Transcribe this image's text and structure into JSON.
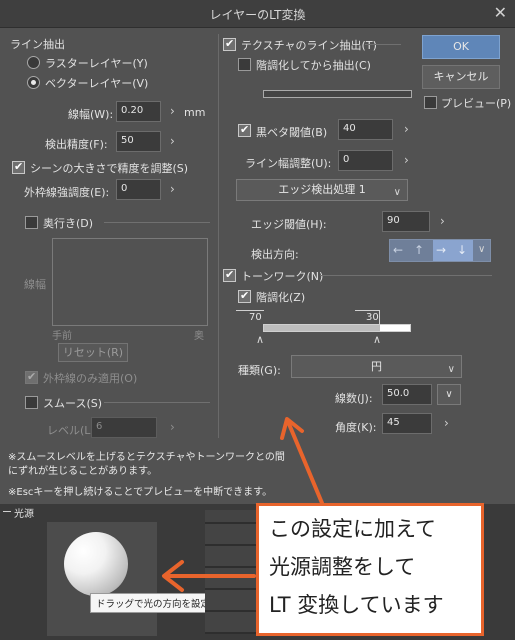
{
  "dialog": {
    "title": "レイヤーのLT変換",
    "close_glyph": "✕"
  },
  "line_extract": {
    "section": "ライン抽出",
    "raster": "ラスターレイヤー(Y)",
    "vector": "ベクターレイヤー(V)",
    "width_label": "線幅(W):",
    "width_value": "0.20",
    "width_unit": "mm",
    "precision_label": "検出精度(F):",
    "precision_value": "50",
    "scene_adjust": "シーンの大きさで精度を調整(S)",
    "outline_label": "外枠線強調度(E):",
    "outline_value": "0",
    "depth": "奥行き(D)",
    "graph_ylabel": "線幅",
    "graph_near": "手前",
    "graph_far": "奥",
    "reset": "リセット(R)",
    "outline_only": "外枠線のみ適用(O)",
    "smooth": "スムース(S)",
    "level_label": "レベル(L):",
    "level_value": "6"
  },
  "texture": {
    "extract": "テクスチャのライン抽出(T)",
    "after_tone": "階調化してから抽出(C)",
    "black_threshold_label": "黒ベタ閾値(B)",
    "black_threshold_value": "40",
    "line_width_adjust_label": "ライン幅調整(U):",
    "line_width_adjust_value": "0",
    "edge_process": "エッジ検出処理 1",
    "edge_threshold_label": "エッジ閾値(H):",
    "edge_threshold_value": "90",
    "direction_label": "検出方向:"
  },
  "buttons": {
    "ok": "OK",
    "cancel": "キャンセル",
    "preview": "プレビュー(P)"
  },
  "tonework": {
    "section": "トーンワーク(N)",
    "gradation": "階調化(Z)",
    "left_value": "70",
    "right_value": "30",
    "type_label": "種類(G):",
    "type_value": "円",
    "lines_label": "線数(J):",
    "lines_value": "50.0",
    "angle_label": "角度(K):",
    "angle_value": "45"
  },
  "notes": {
    "smooth_note": "※スムースレベルを上げるとテクスチャやトーンワークとの間にずれが生じることがあります。",
    "esc_note": "※Escキーを押し続けることでプレビューを中断できます。"
  },
  "light": {
    "section": "光源",
    "tooltip": "ドラッグで光の方向を設定します"
  },
  "callout": {
    "line1": "この設定に加えて",
    "line2": "光源調整をして",
    "line3": "LT 変換しています"
  },
  "icons": [
    "close-icon",
    "chevron-right-icon",
    "chevron-down-icon",
    "arrow-left-icon",
    "arrow-up-icon",
    "arrow-right-icon",
    "arrow-down-icon",
    "checkmark-icon"
  ],
  "colors": {
    "panel": "#525252",
    "titlebar": "#3f3f3f",
    "primary_button": "#5f86b8",
    "callout_border": "#e8642c"
  }
}
